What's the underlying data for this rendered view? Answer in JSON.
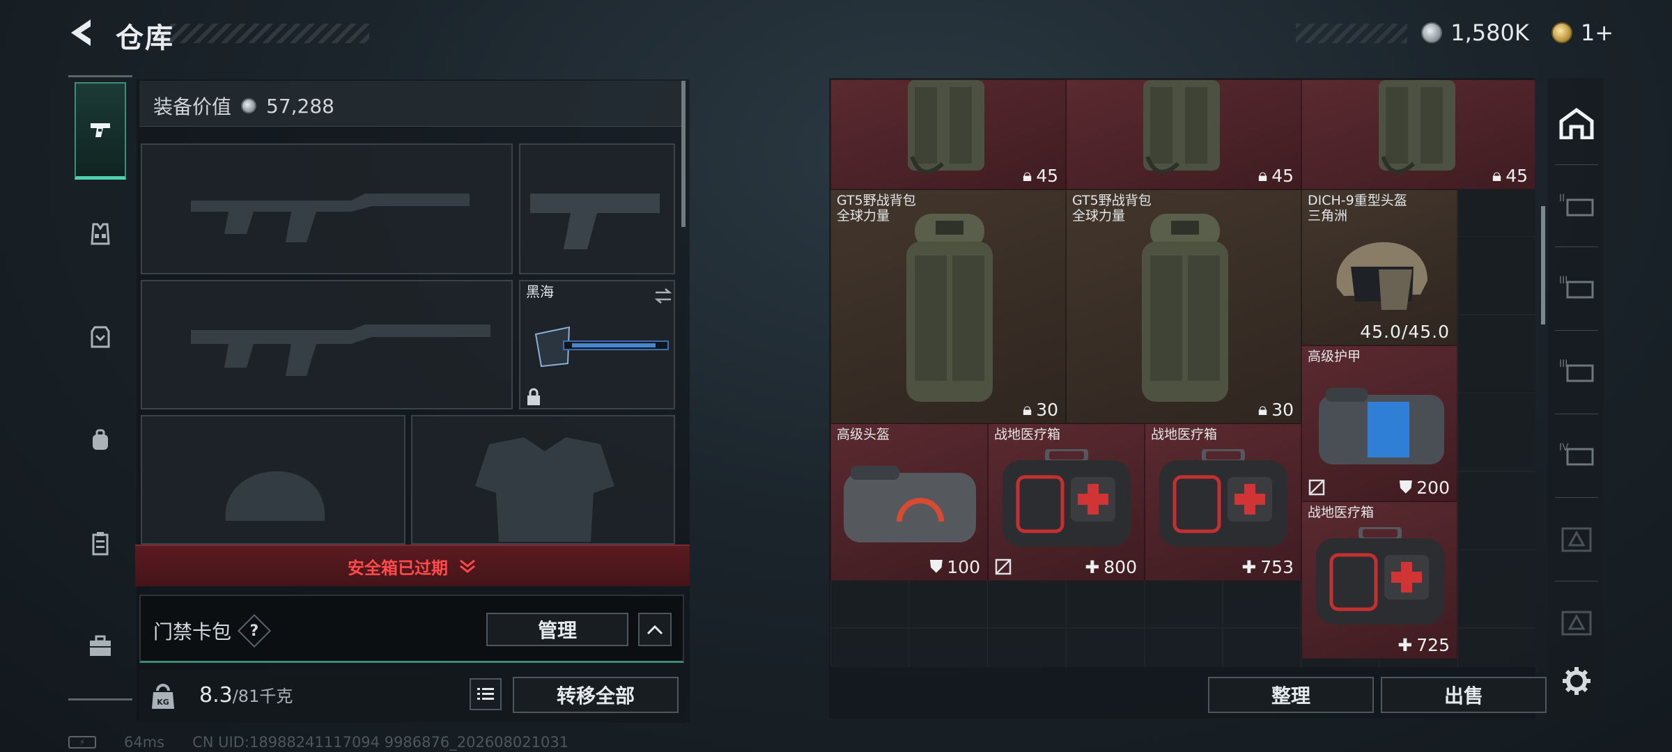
{
  "header": {
    "title": "仓库",
    "currencies": [
      {
        "icon": "silver-coin-icon",
        "value": "1,580K"
      },
      {
        "icon": "gold-coin-icon",
        "value": "1+"
      }
    ]
  },
  "loadout": {
    "equipment_value_label": "装备价值",
    "equipment_value": "57,288",
    "melee_slot_name": "黑海",
    "safebox_notice": "安全箱已过期",
    "keycard_label": "门禁卡包",
    "keycard_help": "?",
    "manage_button": "管理",
    "weight_current": "8.3",
    "weight_max": "/81千克",
    "weight_icon_text": "KG",
    "transfer_all_button": "转移全部"
  },
  "footer": {
    "ping": "64ms",
    "uid": "CN UID:18988241117094 9986876_202608021031"
  },
  "stash": {
    "items": [
      {
        "name": "",
        "sub": "",
        "value": "45",
        "stat": "capacity"
      },
      {
        "name": "",
        "sub": "",
        "value": "45",
        "stat": "capacity"
      },
      {
        "name": "",
        "sub": "",
        "value": "45",
        "stat": "capacity"
      },
      {
        "name": "GT5野战背包",
        "sub": "全球力量",
        "value": "30",
        "stat": "capacity"
      },
      {
        "name": "GT5野战背包",
        "sub": "全球力量",
        "value": "30",
        "stat": "capacity"
      },
      {
        "name": "DICH-9重型头盔",
        "sub": "三角洲",
        "value": "45.0/45.0",
        "stat": "durability"
      },
      {
        "name": "高级护甲",
        "sub": "",
        "value": "200",
        "stat": "armor"
      },
      {
        "name": "高级头盔",
        "sub": "",
        "value": "100",
        "stat": "armor"
      },
      {
        "name": "战地医疗箱",
        "sub": "",
        "value": "800",
        "stat": "heal"
      },
      {
        "name": "战地医疗箱",
        "sub": "",
        "value": "753",
        "stat": "heal"
      },
      {
        "name": "战地医疗箱",
        "sub": "",
        "value": "725",
        "stat": "heal"
      }
    ],
    "sort_button": "整理",
    "sell_button": "出售"
  },
  "colors": {
    "accent": "#4fd0b0",
    "warning": "#ff4b4b",
    "item_red": "#5a2a30",
    "item_brown": "#43362c"
  }
}
